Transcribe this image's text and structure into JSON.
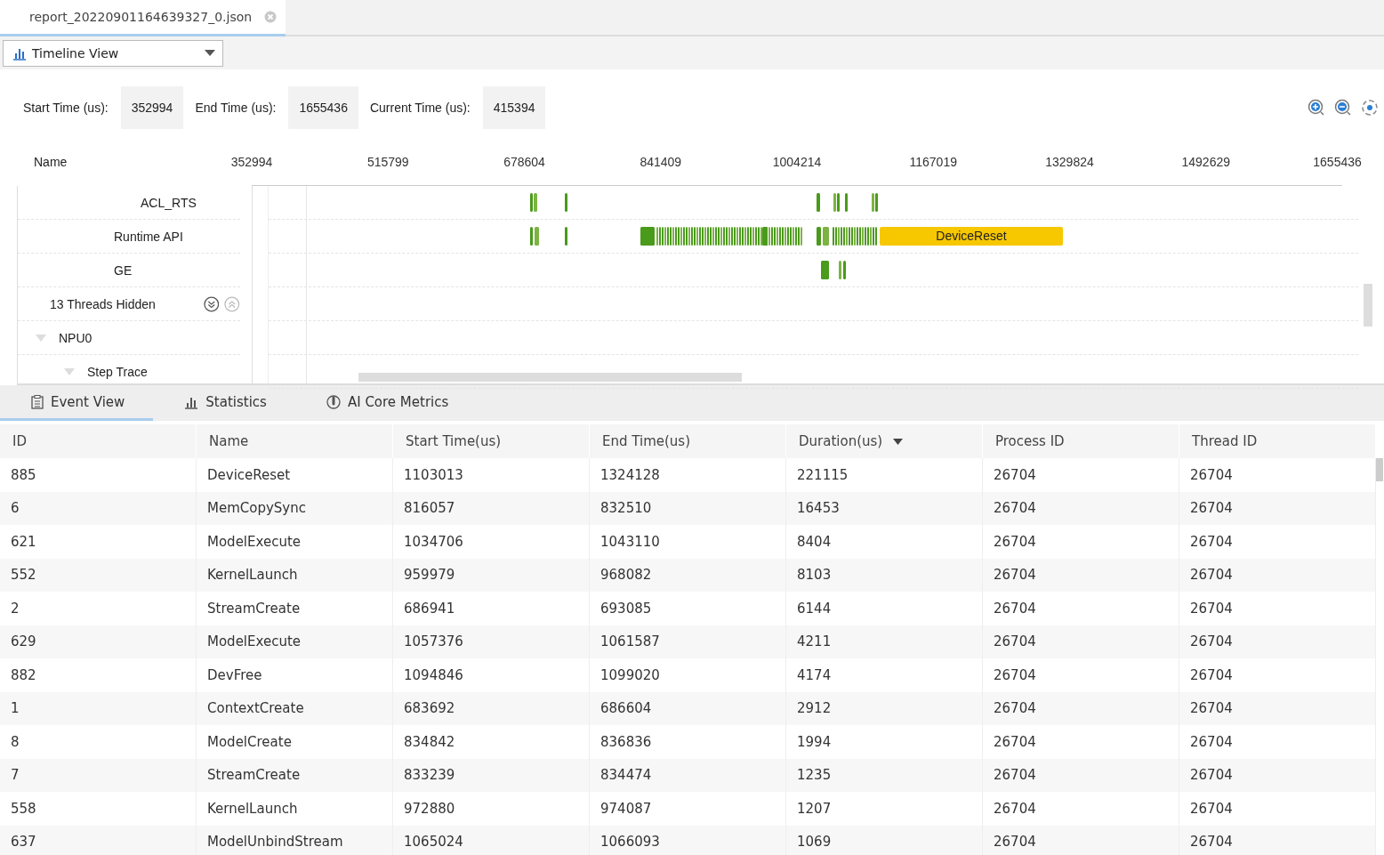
{
  "file_tabs": [
    {
      "label": "report_20220901164639327_0.json",
      "selected": true
    }
  ],
  "view_select": {
    "value": "Timeline View"
  },
  "time_fields": [
    {
      "label": "Start Time (us):",
      "value": "352994"
    },
    {
      "label": "End Time (us):",
      "value": "1655436"
    },
    {
      "label": "Current Time (us):",
      "value": "415394"
    }
  ],
  "timeline": {
    "name_header": "Name",
    "ticks": [
      "352994",
      "515799",
      "678604",
      "841409",
      "1004214",
      "1167019",
      "1329824",
      "1492629",
      "1655436"
    ],
    "tracks": [
      {
        "label": "ACL_RTS",
        "kind": "thread"
      },
      {
        "label": "Runtime API",
        "kind": "thread",
        "event_label": "DeviceReset"
      },
      {
        "label": "GE",
        "kind": "thread"
      },
      {
        "label": "13 Threads Hidden",
        "kind": "hidden"
      },
      {
        "label": "NPU0",
        "kind": "group",
        "expanded": true,
        "children": [
          {
            "label": "Step Trace",
            "kind": "group",
            "expanded": true
          }
        ]
      }
    ]
  },
  "bottom_tabs": [
    {
      "label": "Event View",
      "selected": true,
      "kind": "list"
    },
    {
      "label": "Statistics",
      "selected": false,
      "kind": "bars"
    },
    {
      "label": "AI Core Metrics",
      "selected": false,
      "kind": "metrics"
    }
  ],
  "table": {
    "columns": [
      {
        "label": "ID",
        "sorted": false
      },
      {
        "label": "Name",
        "sorted": false
      },
      {
        "label": "Start Time(us)",
        "sorted": false
      },
      {
        "label": "End Time(us)",
        "sorted": false
      },
      {
        "label": "Duration(us)",
        "sorted": true,
        "descending": true
      },
      {
        "label": "Process ID",
        "sorted": false
      },
      {
        "label": "Thread ID",
        "sorted": false
      }
    ],
    "rows": [
      [
        "885",
        "DeviceReset",
        "1103013",
        "1324128",
        "221115",
        "26704",
        "26704"
      ],
      [
        "6",
        "MemCopySync",
        "816057",
        "832510",
        "16453",
        "26704",
        "26704"
      ],
      [
        "621",
        "ModelExecute",
        "1034706",
        "1043110",
        "8404",
        "26704",
        "26704"
      ],
      [
        "552",
        "KernelLaunch",
        "959979",
        "968082",
        "8103",
        "26704",
        "26704"
      ],
      [
        "2",
        "StreamCreate",
        "686941",
        "693085",
        "6144",
        "26704",
        "26704"
      ],
      [
        "629",
        "ModelExecute",
        "1057376",
        "1061587",
        "4211",
        "26704",
        "26704"
      ],
      [
        "882",
        "DevFree",
        "1094846",
        "1099020",
        "4174",
        "26704",
        "26704"
      ],
      [
        "1",
        "ContextCreate",
        "683692",
        "686604",
        "2912",
        "26704",
        "26704"
      ],
      [
        "8",
        "ModelCreate",
        "834842",
        "836836",
        "1994",
        "26704",
        "26704"
      ],
      [
        "7",
        "StreamCreate",
        "833239",
        "834474",
        "1235",
        "26704",
        "26704"
      ],
      [
        "558",
        "KernelLaunch",
        "972880",
        "974087",
        "1207",
        "26704",
        "26704"
      ],
      [
        "637",
        "ModelUnbindStream",
        "1065024",
        "1066093",
        "1069",
        "26704",
        "26704"
      ]
    ]
  }
}
